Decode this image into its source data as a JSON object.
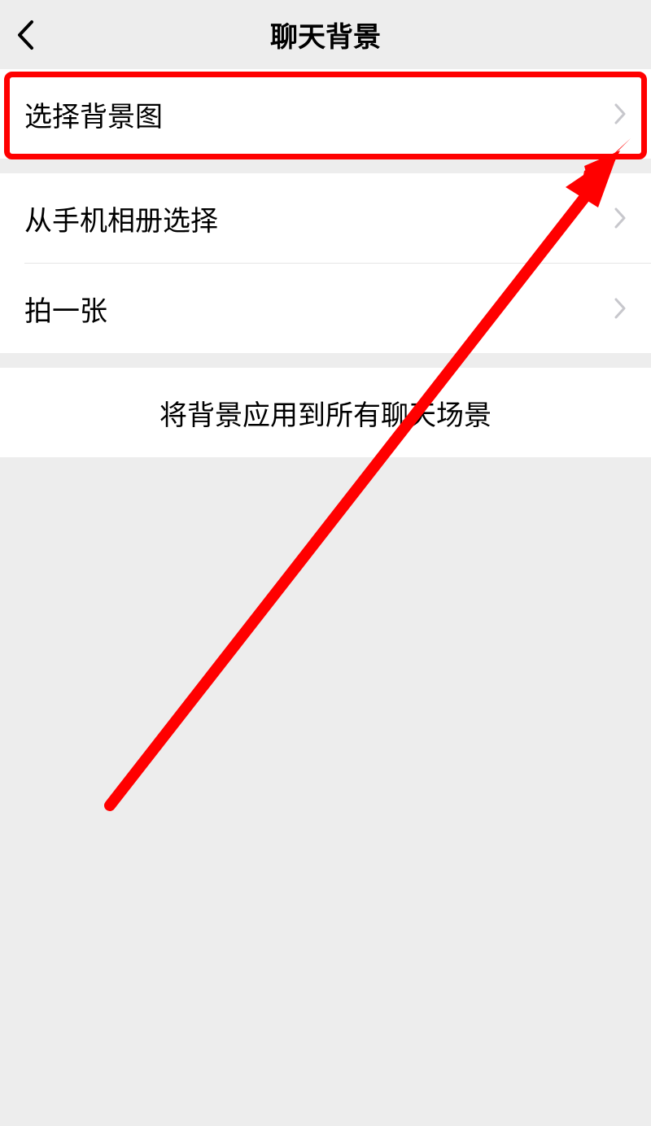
{
  "header": {
    "title": "聊天背景"
  },
  "groups": {
    "first": {
      "select_bg": "选择背景图"
    },
    "second": {
      "from_album": "从手机相册选择",
      "take_photo": "拍一张"
    },
    "third": {
      "apply_all": "将背景应用到所有聊天场景"
    }
  }
}
